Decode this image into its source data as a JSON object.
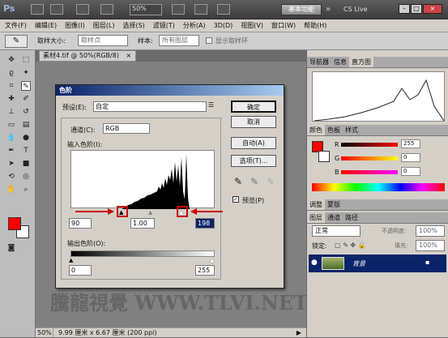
{
  "appbar": {
    "logo": "Ps",
    "zoom": "50%",
    "workspace": "基本功能",
    "cslive": "CS Live",
    "win_min": "–",
    "win_max": "□",
    "win_close": "×"
  },
  "menus": [
    "文件(F)",
    "编辑(E)",
    "图像(I)",
    "图层(L)",
    "选择(S)",
    "滤镜(T)",
    "分析(A)",
    "3D(D)",
    "视图(V)",
    "窗口(W)",
    "帮助(H)"
  ],
  "options": {
    "sample_size_label": "取样大小:",
    "sample_size_value": "取样点",
    "sample_label": "样本:",
    "sample_value": "所有图层",
    "show_ring_label": "显示取样环"
  },
  "document": {
    "tab": "素材4.tif @ 50%(RGB/8)",
    "status_zoom": "50%",
    "status_info": "9.99 厘米 x 6.67 厘米 (200 ppi)"
  },
  "watermark": "騰龍視覺 WWW.TLVI.NET",
  "panels": {
    "nav_tabs": [
      "导航器",
      "信息",
      "直方图"
    ],
    "color_tabs": [
      "颜色",
      "色板",
      "样式"
    ],
    "color_values": {
      "R": "255",
      "G": "0",
      "B": "0"
    },
    "adj_tabs": [
      "调整",
      "蒙版"
    ],
    "layer_tabs": [
      "图层",
      "通道",
      "路径"
    ],
    "blend_mode": "正常",
    "opacity_label": "不透明度:",
    "opacity_value": "100%",
    "lock_label": "锁定:",
    "fill_label": "填充:",
    "fill_value": "100%",
    "layer_name": "背景"
  },
  "dialog": {
    "title": "色阶",
    "preset_label": "预设(E):",
    "preset_value": "自定",
    "channel_label": "通道(C):",
    "channel_value": "RGB",
    "input_levels_label": "输入色阶(I):",
    "input_black": "90",
    "input_gamma": "1.00",
    "input_white": "198",
    "output_levels_label": "输出色阶(O):",
    "output_black": "0",
    "output_white": "255",
    "btn_ok": "确定",
    "btn_cancel": "取消",
    "btn_auto": "自动(A)",
    "btn_options": "选项(T)...",
    "preview_label": "预览(P)"
  },
  "colors": {
    "foreground": "#ff0000",
    "background": "#ffffff",
    "accent": "#cc0000"
  }
}
